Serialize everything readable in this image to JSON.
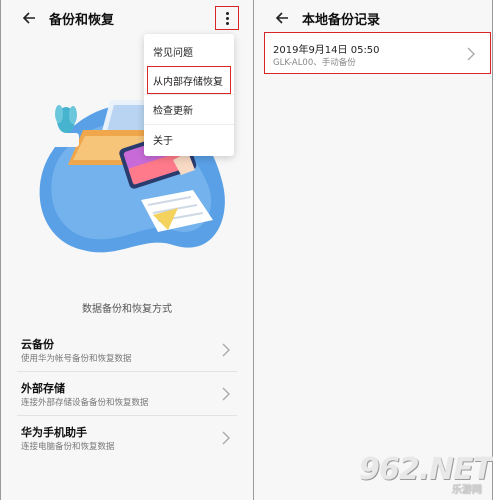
{
  "left": {
    "title": "备份和恢复",
    "menu": {
      "items": [
        {
          "label": "常见问题"
        },
        {
          "label": "从内部存储恢复"
        },
        {
          "label": "检查更新"
        },
        {
          "label": "关于"
        }
      ],
      "highlighted": "从内部存储恢复"
    },
    "section_title": "数据备份和恢复方式",
    "options": [
      {
        "title": "云备份",
        "subtitle": "使用华为帐号备份和恢复数据"
      },
      {
        "title": "外部存储",
        "subtitle": "连接外部存储设备备份和恢复数据"
      },
      {
        "title": "华为手机助手",
        "subtitle": "连接电脑备份和恢复数据"
      }
    ]
  },
  "right": {
    "title": "本地备份记录",
    "record": {
      "date": "2019年9月14日 05:50",
      "device": "GLK-AL00、手动备份"
    }
  },
  "watermark": {
    "main": "962.NET",
    "sub": "乐游网"
  },
  "colors": {
    "highlight": "#d7262a",
    "accent": "#3f7ae0"
  }
}
